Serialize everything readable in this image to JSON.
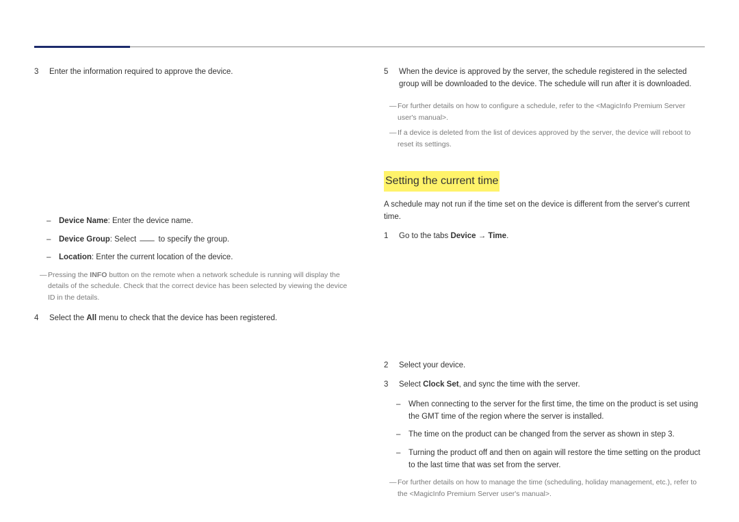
{
  "left": {
    "step3": "Enter the information required to approve the device.",
    "sub_device_name_label": "Device Name",
    "sub_device_name_text": ": Enter the device name.",
    "sub_device_group_label": "Device Group",
    "sub_device_group_text": ": Select",
    "sub_device_group_text2": "to specify the group.",
    "sub_location_label": "Location",
    "sub_location_text": ": Enter the current location of the device.",
    "note_info1": "Pressing the ",
    "note_info_bold": "INFO",
    "note_info2": " button on the remote when a network schedule is running will display the details of the schedule. Check that the correct device has been selected by viewing the device ID in the details.",
    "step4_a": "Select the ",
    "step4_bold": "All",
    "step4_b": " menu to check that the device has been registered."
  },
  "right": {
    "step5": "When the device is approved by the server, the schedule registered in the selected group will be downloaded to the device. The schedule will run after it is downloaded.",
    "note1": "For further details on how to configure a schedule, refer to the <MagicInfo Premium Server user's manual>.",
    "note2": "If a device is deleted from the list of devices approved by the server, the device will reboot to reset its settings.",
    "section_title": "Setting the current time",
    "para1": "A schedule may not run if the time set on the device is different from the server's current time.",
    "step1_a": "Go to the tabs ",
    "step1_b1": "Device",
    "step1_arrow": " → ",
    "step1_b2": "Time",
    "step1_c": ".",
    "step_r2": "Select your device.",
    "step_r3_a": "Select ",
    "step_r3_bold": "Clock Set",
    "step_r3_b": ", and sync the time with the server.",
    "sub_r1": "When connecting to the server for the first time, the time on the product is set using the GMT time of the region where the server is installed.",
    "sub_r2": "The time on the product can be changed from the server as shown in step 3.",
    "sub_r3": "Turning the product off and then on again will restore the time setting on the product to the last time that was set from the server.",
    "note3": "For further details on how to manage the time (scheduling, holiday management, etc.), refer to the <MagicInfo Premium Server user's manual>.",
    "btn_placeholder": " "
  },
  "nums": {
    "n3": "3",
    "n4": "4",
    "n5": "5",
    "n1r": "1",
    "n2r": "2",
    "n3r": "3",
    "dash": "‒",
    "bullet": "―"
  }
}
